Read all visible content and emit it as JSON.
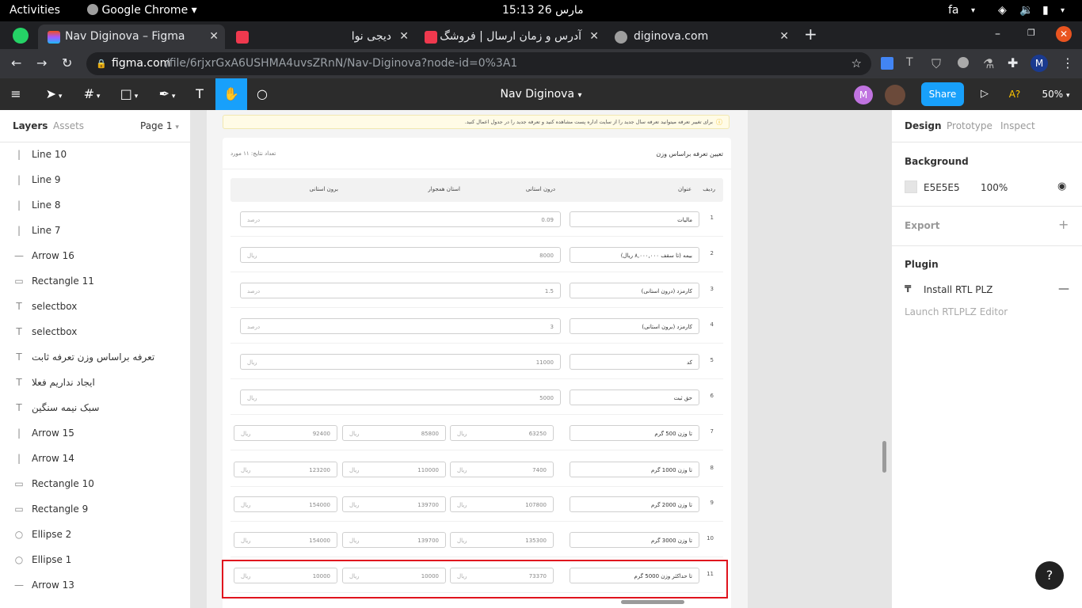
{
  "topbar": {
    "activities": "Activities",
    "app": "Google Chrome",
    "clock": "15:13  26 مارس",
    "lang": "fa"
  },
  "tabs": [
    {
      "title": "Nav Diginova – Figma"
    },
    {
      "title": "دیجی نوا"
    },
    {
      "title": "آدرس و زمان ارسال | فروشگ"
    },
    {
      "title": "diginova.com"
    }
  ],
  "address": {
    "url_host": "figma.com",
    "url_path": "/file/6rjxrGxA6USHMA4uvsZRnN/Nav-Diginova?node-id=0%3A1",
    "avatar": "M"
  },
  "figma": {
    "file_title": "Nav Diginova",
    "share": "Share",
    "zoom": "50%",
    "a_badge": "A?",
    "user_initial": "M"
  },
  "left": {
    "tabs": [
      "Layers",
      "Assets"
    ],
    "page": "Page 1",
    "layers": [
      {
        "icon": "line-icon",
        "name": "Line 10"
      },
      {
        "icon": "line-icon",
        "name": "Line 9"
      },
      {
        "icon": "line-icon",
        "name": "Line 8"
      },
      {
        "icon": "line-icon",
        "name": "Line 7"
      },
      {
        "icon": "arrow-icon",
        "name": "Arrow 16"
      },
      {
        "icon": "rectangle-icon",
        "name": "Rectangle 11"
      },
      {
        "icon": "text-icon",
        "name": "selectbox"
      },
      {
        "icon": "text-icon",
        "name": "selectbox"
      },
      {
        "icon": "text-icon",
        "name": "تعرفه براساس وزن تعرفه ثابت"
      },
      {
        "icon": "text-icon",
        "name": "ایجاد نداریم فعلا"
      },
      {
        "icon": "text-icon",
        "name": "سبک نیمه سنگین"
      },
      {
        "icon": "line-icon",
        "name": "Arrow 15"
      },
      {
        "icon": "line-icon",
        "name": "Arrow 14"
      },
      {
        "icon": "rectangle-icon",
        "name": "Rectangle 10"
      },
      {
        "icon": "rectangle-icon",
        "name": "Rectangle 9"
      },
      {
        "icon": "ellipse-icon",
        "name": "Ellipse 2"
      },
      {
        "icon": "ellipse-icon",
        "name": "Ellipse 1"
      },
      {
        "icon": "arrow-icon",
        "name": "Arrow 13"
      }
    ]
  },
  "canvas": {
    "notice": "برای تغییر تعرفه میتوانید تعرفه سال جدید را از سایت اداره پست مشاهده کنید و تعرفه جدید را در جدول اعمال کنید.",
    "card_title": "تعیین تعرفه براساس وزن",
    "result_count": "تعداد نتایج: ۱۱ مورد",
    "headers": {
      "row": "ردیف",
      "title": "عنوان",
      "in_prov": "درون استانی",
      "neighbor": "استان همجوار",
      "out_prov": "برون استانی"
    },
    "rows": [
      {
        "n": "1",
        "title": "مالیات",
        "vals": [
          [
            "0.09",
            "درصد"
          ]
        ]
      },
      {
        "n": "2",
        "title": "بیمه (تا سقف ۸,۰۰۰,۰۰۰ ریال)",
        "vals": [
          [
            "8000",
            "ریال"
          ]
        ]
      },
      {
        "n": "3",
        "title": "کارمزد (درون استانی)",
        "vals": [
          [
            "1.5",
            "درصد"
          ]
        ]
      },
      {
        "n": "4",
        "title": "کارمزد (برون استانی)",
        "vals": [
          [
            "3",
            "درصد"
          ]
        ]
      },
      {
        "n": "5",
        "title": "کد",
        "vals": [
          [
            "11000",
            "ریال"
          ]
        ]
      },
      {
        "n": "6",
        "title": "حق ثبت",
        "vals": [
          [
            "5000",
            "ریال"
          ]
        ]
      },
      {
        "n": "7",
        "title": "تا وزن 500 گرم",
        "vals": [
          [
            "63250",
            "ریال"
          ],
          [
            "85800",
            "ریال"
          ],
          [
            "92400",
            "ریال"
          ]
        ]
      },
      {
        "n": "8",
        "title": "تا وزن 1000 گرم",
        "vals": [
          [
            "7400",
            "ریال"
          ],
          [
            "110000",
            "ریال"
          ],
          [
            "123200",
            "ریال"
          ]
        ]
      },
      {
        "n": "9",
        "title": "تا وزن 2000 گرم",
        "vals": [
          [
            "107800",
            "ریال"
          ],
          [
            "139700",
            "ریال"
          ],
          [
            "154000",
            "ریال"
          ]
        ]
      },
      {
        "n": "10",
        "title": "تا وزن 3000 گرم",
        "vals": [
          [
            "135300",
            "ریال"
          ],
          [
            "139700",
            "ریال"
          ],
          [
            "154000",
            "ریال"
          ]
        ]
      },
      {
        "n": "11",
        "title": "تا حداکثر وزن 5000 گرم",
        "vals": [
          [
            "73370",
            "ریال"
          ],
          [
            "10000",
            "ریال"
          ],
          [
            "10000",
            "ریال"
          ]
        ]
      }
    ]
  },
  "right": {
    "tabs": [
      "Design",
      "Prototype",
      "Inspect"
    ],
    "background_label": "Background",
    "bg_hex": "E5E5E5",
    "bg_opacity": "100%",
    "export_label": "Export",
    "plugin_label": "Plugin",
    "plugin_name": "Install RTL PLZ",
    "plugin_action": "Launch RTLPLZ Editor"
  },
  "help": "?"
}
